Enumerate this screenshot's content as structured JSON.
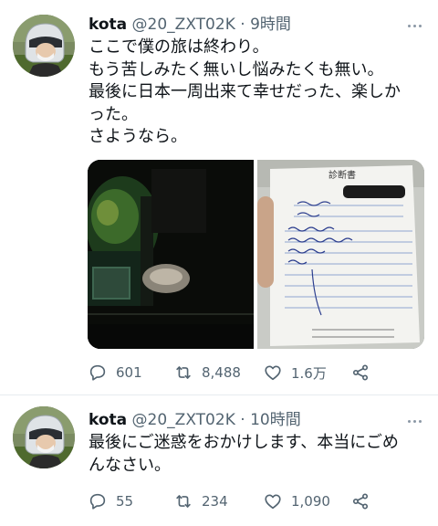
{
  "tweets": [
    {
      "name": "kota",
      "handle": "@20_ZXT02K",
      "separator": "·",
      "time": "9時間",
      "lines": [
        "ここで僕の旅は終わり。",
        "もう苦しみたく無いし悩みたくも無い。",
        "最後に日本一周出来て幸せだった、楽しか",
        "った。",
        "さようなら。"
      ],
      "document": {
        "title": "診断書"
      },
      "replies": "601",
      "retweets": "8,488",
      "likes": "1.6万"
    },
    {
      "name": "kota",
      "handle": "@20_ZXT02K",
      "separator": "·",
      "time": "10時間",
      "lines": [
        "最後にご迷惑をおかけします、本当にごめ",
        "んなさい。"
      ],
      "replies": "55",
      "retweets": "234",
      "likes": "1,090"
    }
  ],
  "icons": {
    "reply": "speech-bubble",
    "retweet": "arrows-loop",
    "like": "heart",
    "share": "share-nodes",
    "more": "three-dots"
  },
  "colors": {
    "text": "#0f1419",
    "secondary": "#536471",
    "divider": "#e6ecf0"
  }
}
